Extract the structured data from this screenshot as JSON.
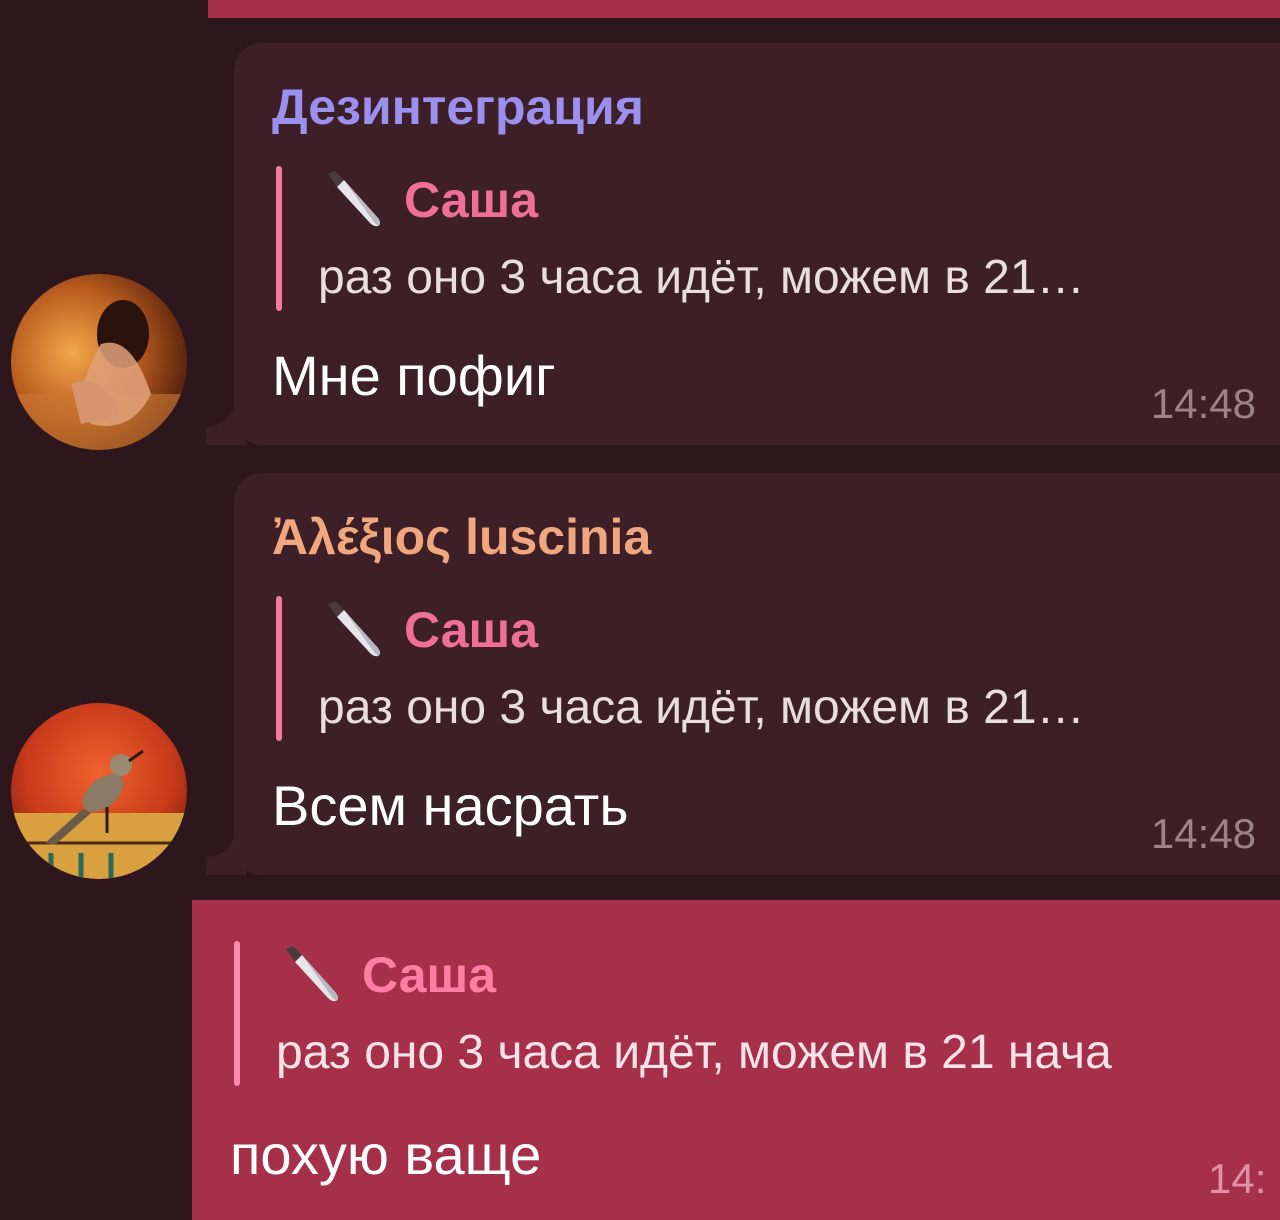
{
  "messages": [
    {
      "sender": "Дезинтеграция",
      "reply": {
        "icon": "knife-icon",
        "name": "Саша",
        "text": "раз оно 3 часа идёт, можем в 21…"
      },
      "text": "Мне пофиг",
      "time": "14:48"
    },
    {
      "sender": "Ἀλέξιος luscinia",
      "reply": {
        "icon": "knife-icon",
        "name": "Саша",
        "text": "раз оно 3 часа идёт, можем в 21…"
      },
      "text": "Всем насрать",
      "time": "14:48"
    }
  ],
  "own_message": {
    "reply": {
      "icon": "knife-icon",
      "name": "Саша",
      "text": "раз оно 3 часа идёт, можем в 21 нача"
    },
    "text": "похую ваще",
    "time": "14:"
  },
  "colors": {
    "background": "#2d171d",
    "incoming_bubble": "#3d1f27",
    "outgoing_bubble": "#a63049",
    "sender_1": "#9b8ff0",
    "sender_2": "#f0a77e",
    "reply_name": "#f06e9a"
  }
}
